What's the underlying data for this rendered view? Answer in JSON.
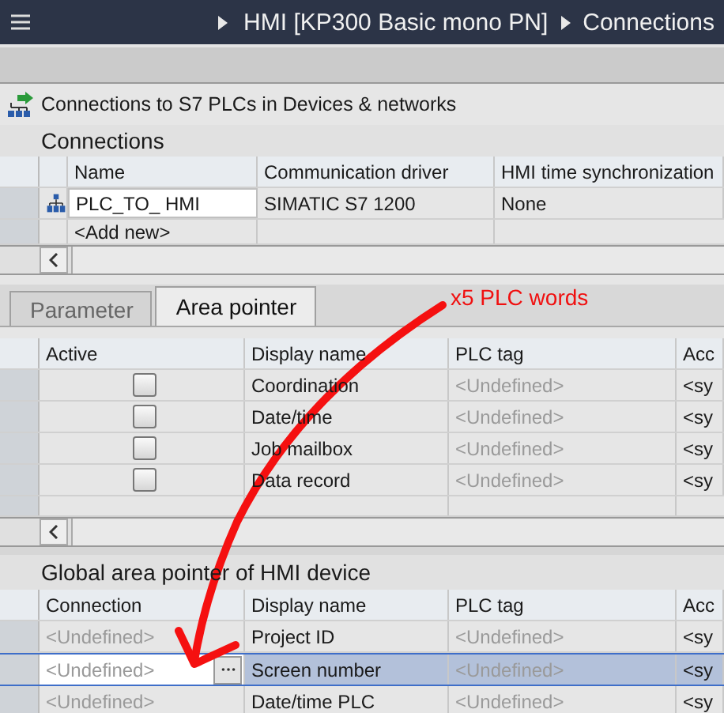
{
  "breadcrumb": [
    {
      "label": "HMI [KP300 Basic mono PN]"
    },
    {
      "label": "Connections"
    }
  ],
  "devices_link": "Connections to S7 PLCs in Devices & networks",
  "connections": {
    "title": "Connections",
    "columns": [
      "Name",
      "Communication driver",
      "HMI time synchronization"
    ],
    "rows": [
      {
        "name": "PLC_TO_ HMI",
        "driver": "SIMATIC S7 1200",
        "sync": "None"
      }
    ],
    "add_new": "<Add new>"
  },
  "tabs": [
    {
      "label": "Parameter",
      "selected": false
    },
    {
      "label": "Area pointer",
      "selected": true
    }
  ],
  "area_pointer": {
    "columns": [
      "Active",
      "Display name",
      "PLC tag",
      "Acc"
    ],
    "rows": [
      {
        "active": false,
        "display_name": "Coordination",
        "plc_tag": "<Undefined>",
        "column_4": "<sy"
      },
      {
        "active": false,
        "display_name": "Date/time",
        "plc_tag": "<Undefined>",
        "column_4": "<sy"
      },
      {
        "active": false,
        "display_name": "Job mailbox",
        "plc_tag": "<Undefined>",
        "column_4": "<sy"
      },
      {
        "active": false,
        "display_name": "Data record",
        "plc_tag": "<Undefined>",
        "column_4": "<sy"
      }
    ]
  },
  "global": {
    "title": "Global area pointer of HMI device",
    "columns": [
      "Connection",
      "Display name",
      "PLC tag",
      "Acc"
    ],
    "rows": [
      {
        "connection": "<Undefined>",
        "display_name": "Project ID",
        "plc_tag": "<Undefined>",
        "column_4": "<sy",
        "selected": false
      },
      {
        "connection": "<Undefined>",
        "display_name": "Screen number",
        "plc_tag": "<Undefined>",
        "column_4": "<sy",
        "selected": true
      },
      {
        "connection": "<Undefined>",
        "display_name": "Date/time PLC",
        "plc_tag": "<Undefined>",
        "column_4": "<sy",
        "selected": false
      }
    ]
  },
  "annotation": {
    "label": "x5 PLC words"
  }
}
